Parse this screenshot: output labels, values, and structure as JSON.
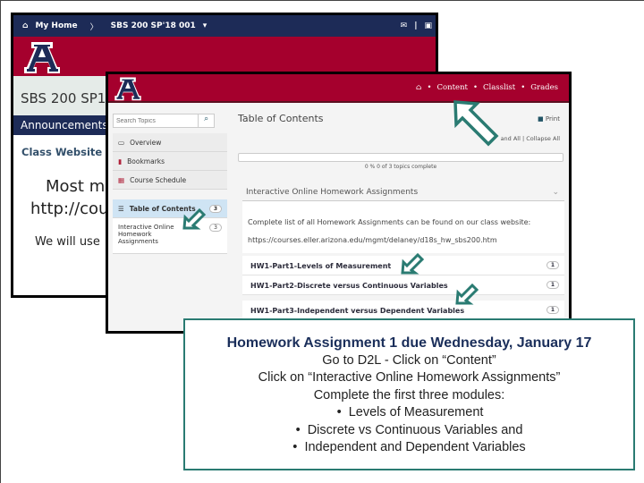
{
  "accent_colors": {
    "navy": "#1d2b57",
    "red": "#a5002d",
    "teal": "#2a7b72"
  },
  "back_window": {
    "nav": {
      "home_label": "My Home",
      "course_label": "SBS 200 SP'18 001",
      "icons": [
        "home-icon",
        "chevron-right-icon",
        "caret-down-icon",
        "mail-icon",
        "chat-icon"
      ]
    },
    "course_title": "SBS 200 SP1",
    "announcements_label": "Announcements",
    "class_website_label": "Class Website",
    "text_line1": "Most ma",
    "text_line2": "http://cou",
    "text_line3": "We will use"
  },
  "front_window": {
    "nav": {
      "items": [
        "Content",
        "Classlist",
        "Grades"
      ]
    },
    "search_placeholder": "Search Topics",
    "sidebar": [
      {
        "label": "Overview",
        "icon": "presentation-icon"
      },
      {
        "label": "Bookmarks",
        "icon": "bookmark-icon"
      },
      {
        "label": "Course Schedule",
        "icon": "calendar-icon"
      }
    ],
    "toc": {
      "label": "Table of Contents",
      "count": "3"
    },
    "module": {
      "label": "Interactive Online Homework Assignments",
      "count": "3"
    },
    "page_title": "Table of Contents",
    "print_label": "Print",
    "expand_label": "and All",
    "collapse_label": "Collapse All",
    "progress": {
      "percent": 0,
      "text": "0 %   0 of 3 topics complete"
    },
    "section_title": "Interactive Online Homework Assignments",
    "description": "Complete list of all Homework Assignments can be found on our class website:",
    "url": "https://courses.eller.arizona.edu/mgmt/delaney/d18s_hw_sbs200.htm",
    "items": [
      {
        "label": "HW1-Part1-Levels of Measurement",
        "count": "1"
      },
      {
        "label": "HW1-Part2-Discrete versus Continuous Variables",
        "count": "1"
      },
      {
        "label": "HW1-Part3-Independent versus Dependent Variables",
        "count": "1"
      }
    ]
  },
  "callout": {
    "title": "Homework Assignment 1 due Wednesday, January 17",
    "lines": [
      "Go to D2L - Click on “Content”",
      "Click on “Interactive Online Homework Assignments”",
      "Complete the first three modules:"
    ],
    "bullets": [
      "Levels of Measurement",
      "Discrete vs Continuous Variables and",
      "Independent and Dependent Variables"
    ]
  }
}
